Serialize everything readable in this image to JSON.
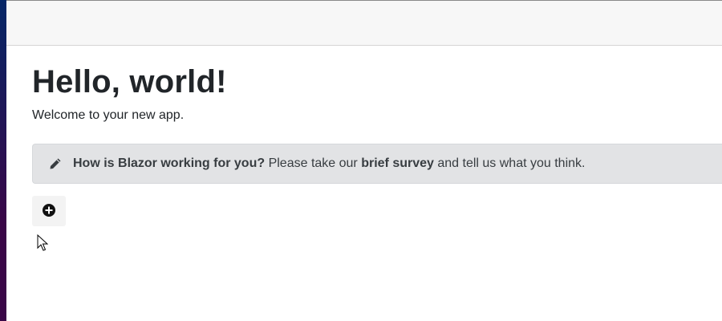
{
  "main": {
    "title": "Hello, world!",
    "welcome": "Welcome to your new app."
  },
  "survey": {
    "question": "How is Blazor working for you?",
    "prompt_before": " Please take our ",
    "link_label": "brief survey",
    "prompt_after": " and tell us what you think.",
    "icon": "pencil-icon"
  },
  "add_button": {
    "icon": "plus-circle-icon"
  },
  "colors": {
    "sidebar_top": "#052767",
    "sidebar_bottom": "#3a0647",
    "top_row_bg": "#f7f7f7",
    "alert_bg": "#e2e3e5",
    "text": "#212529"
  }
}
